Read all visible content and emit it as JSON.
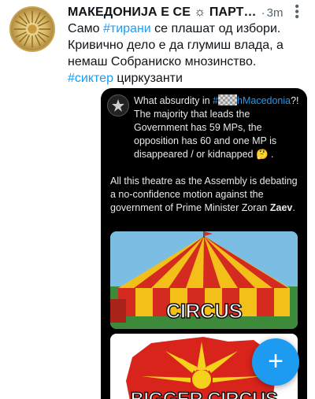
{
  "tweet": {
    "author_name": "МАКЕДОНИЈА Е СЕ ☼ ПАРТ…",
    "separator": "·",
    "timestamp": "3m",
    "more_icon": "more-dots-icon",
    "text_part1": "Само ",
    "hashtag1": "#тирани",
    "text_part2": " се плашат од избори. Кривично дело е да глумиш влада, а немаш Собраниско мнозинство. ",
    "hashtag2": "#сиктер",
    "text_part3": " циркузанти"
  },
  "embedded": {
    "line1_prefix": "What absurdity in ",
    "hashtag_prefix": "#",
    "hashtag_suffix": "hMacedonia",
    "line1_suffix": "?! The majority that leads the Government has 59 MPs, the opposition has 60 and one MP is disappeared / or kidnapped 🤔 .",
    "paragraph2": "All this theatre as the Assembly is debating a no-confidence motion against the government of Prime Minister Zoran ",
    "paragraph2_bold": "Zaev",
    "paragraph2_end": ".",
    "image1_label": "CIRCUS",
    "image2_label": "BIGGER CIRCUS"
  },
  "fab": {
    "label": "+",
    "icon": "compose-plus-icon"
  },
  "colors": {
    "accent": "#1d9bf0",
    "text": "#0f1419",
    "muted": "#536471",
    "media_bg": "#000000"
  }
}
